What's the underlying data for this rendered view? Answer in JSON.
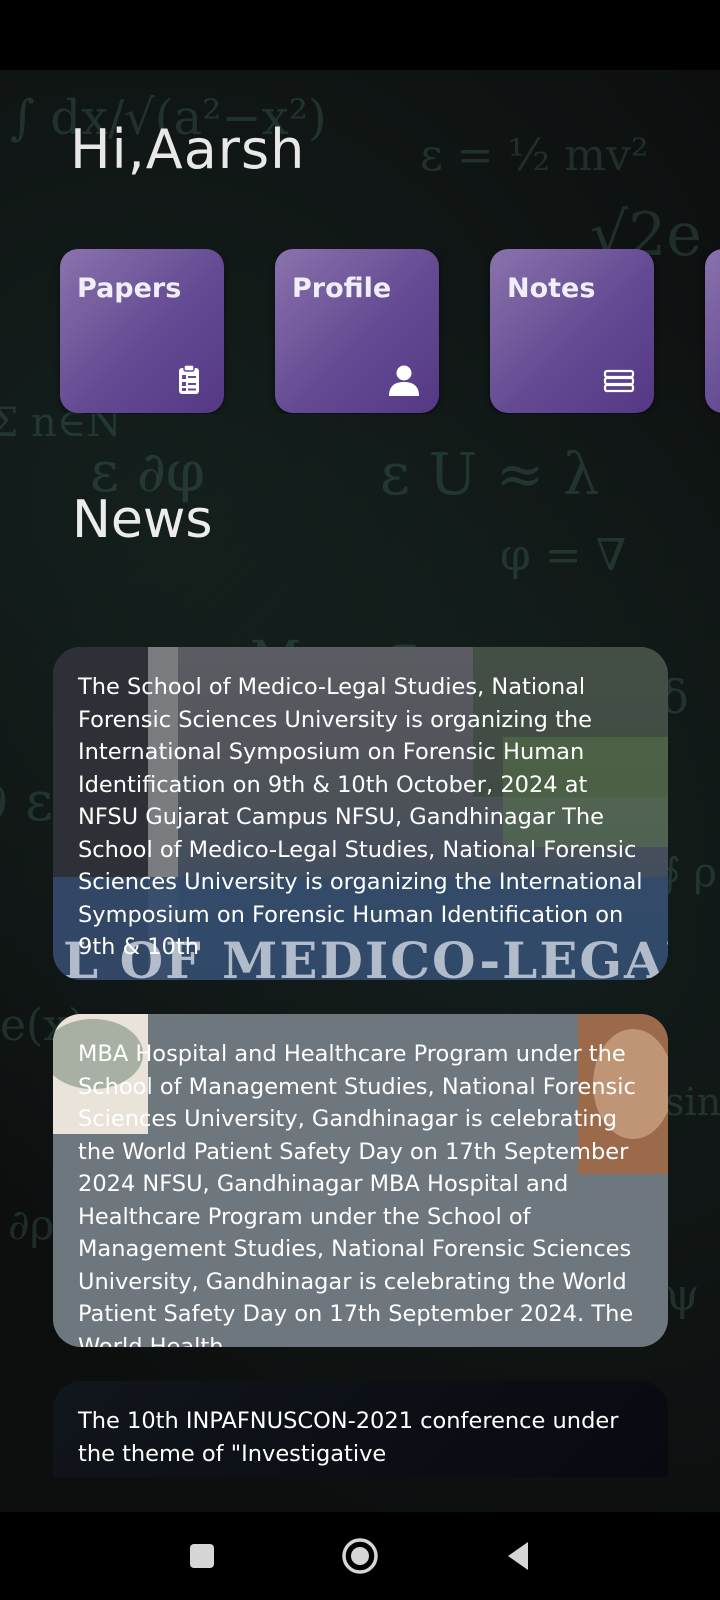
{
  "greeting": "Hi,Aarsh",
  "quick_links": [
    {
      "label": "Papers",
      "icon": "clipboard-icon"
    },
    {
      "label": "Profile",
      "icon": "person-icon"
    },
    {
      "label": "Notes",
      "icon": "books-icon"
    }
  ],
  "news_title": "News",
  "news": [
    {
      "text": "The School of Medico-Legal Studies, National Forensic Sciences University is organizing the International Symposium on Forensic Human Identification on 9th & 10th October, 2024 at NFSU Gujarat Campus NFSU, Gandhinagar The School of Medico-Legal Studies, National Forensic Sciences University is organizing the International Symposium on Forensic Human Identification on 9th & 10th",
      "image_caption": "L OF MEDICO-LEGAL S"
    },
    {
      "text": "MBA Hospital and Healthcare Program under the School of Management Studies, National Forensic Sciences University, Gandhinagar is celebrating the World Patient Safety Day on 17th September 2024 NFSU, Gandhinagar MBA Hospital and Healthcare Program under the School of Management Studies, National Forensic Sciences University, Gandhinagar is celebrating the World Patient Safety Day on 17th September 2024. The World Health"
    },
    {
      "text": "The 10th INPAFNUSCON-2021 conference under the theme of \"Investigative"
    }
  ],
  "nav": {
    "recents": "recents-icon",
    "home": "home-icon",
    "back": "back-icon"
  },
  "colors": {
    "card_purple": "#634a93",
    "background": "#0d0f0f"
  }
}
